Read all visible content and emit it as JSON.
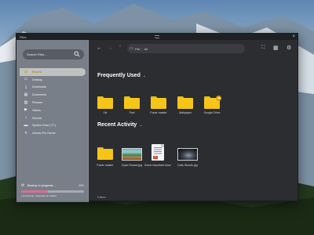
{
  "window": {
    "title": "Files",
    "close_glyph": "×"
  },
  "sidebar": {
    "search_placeholder": "Search Files...",
    "items": [
      {
        "label": "Recent",
        "icon": "clock-icon",
        "glyph": "◷",
        "active": true
      },
      {
        "label": "Desktop",
        "icon": "desktop-icon",
        "glyph": "▭",
        "active": false
      },
      {
        "label": "Downloads",
        "icon": "download-icon",
        "glyph": "⤓",
        "active": false
      },
      {
        "label": "Documents",
        "icon": "document-icon",
        "glyph": "▤",
        "active": false
      },
      {
        "label": "Pictures",
        "icon": "image-icon",
        "glyph": "▨",
        "active": false
      },
      {
        "label": "Videos",
        "icon": "video-icon",
        "glyph": "▶",
        "active": false
      },
      {
        "label": "Sounds",
        "icon": "music-icon",
        "glyph": "♪",
        "active": false
      },
      {
        "label": "System Drive (\"C\")",
        "icon": "drive-icon",
        "glyph": "▬",
        "active": false
      },
      {
        "label": "Ubuntu Pro Server",
        "icon": "server-icon",
        "glyph": "⟡",
        "active": false
      }
    ],
    "backup": {
      "label": "Backup in progress...",
      "percent_text": "43%",
      "progress": 0.43,
      "subtext": "Last backup: Yesterday at 4:00pm"
    }
  },
  "toolbar": {
    "back_glyph": "←",
    "forward_glyph": "→",
    "up_glyph": "⌃",
    "path": [
      "File",
      "All"
    ],
    "screenshot_glyph": "⛶",
    "grid_glyph": "▦",
    "settings_glyph": "⚙"
  },
  "main": {
    "frequently_used_title": "Frequently Used",
    "frequent_folders": [
      {
        "label": "Lib"
      },
      {
        "label": "Fwd"
      },
      {
        "label": "Fwrar master"
      },
      {
        "label": "Wallpaper"
      },
      {
        "label": "Google Drive",
        "badge": true
      }
    ],
    "recent_activity_title": "Recent Activity",
    "recent_items": [
      {
        "label": "Fwrar master",
        "type": "folder"
      },
      {
        "label": "Cyan-Sunset.jpg",
        "type": "image-canyon"
      },
      {
        "label": "Some important.docx",
        "type": "document"
      },
      {
        "label": "Dark Woods.jpg",
        "type": "image-dark"
      }
    ],
    "status": "5 items"
  },
  "colors": {
    "accent": "#F5C518",
    "progress": "#D97090",
    "window_bg": "#2B2D31"
  }
}
